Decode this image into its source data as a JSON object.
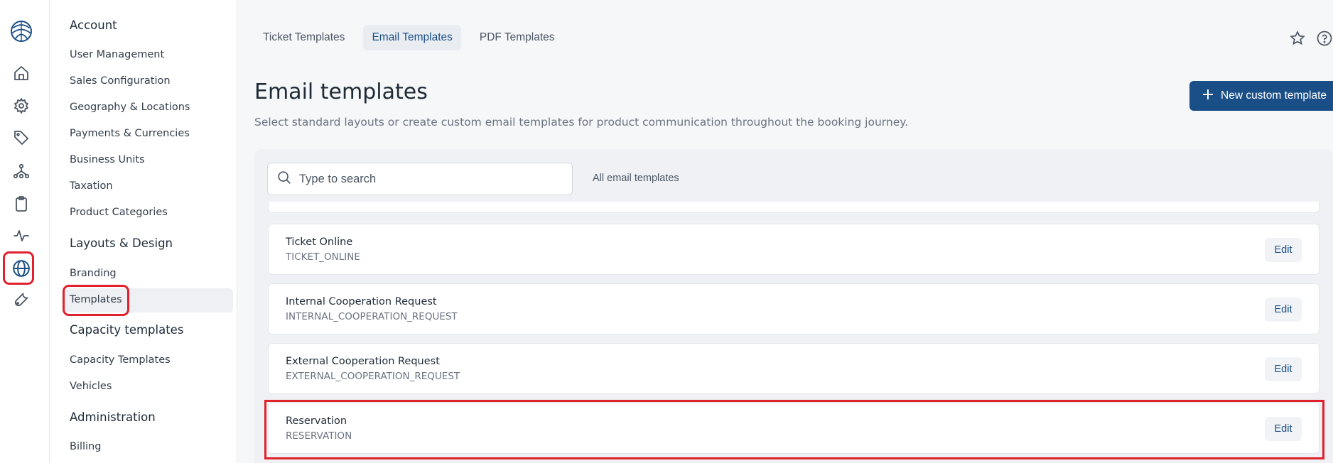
{
  "rail": {
    "icons": [
      "logo-icon",
      "home-icon",
      "settings-gear-icon",
      "tag-icon",
      "network-icon",
      "clipboard-icon",
      "activity-icon",
      "globe-icon",
      "wrench-icon"
    ],
    "active": "globe-icon",
    "highlight_color": "#e0212c"
  },
  "sidebar": {
    "sections": [
      {
        "title": "Account",
        "items": [
          "User Management",
          "Sales Configuration",
          "Geography & Locations",
          "Payments & Currencies",
          "Business Units",
          "Taxation",
          "Product Categories"
        ]
      },
      {
        "title": "Layouts & Design",
        "items": [
          "Branding",
          "Templates"
        ]
      },
      {
        "title": "Capacity templates",
        "items": [
          "Capacity Templates",
          "Vehicles"
        ]
      },
      {
        "title": "Administration",
        "items": [
          "Billing"
        ]
      }
    ],
    "active_item": "Templates"
  },
  "tabs": [
    "Ticket Templates",
    "Email Templates",
    "PDF Templates"
  ],
  "active_tab": "Email Templates",
  "header": {
    "title": "Email templates",
    "subtitle": "Select standard layouts or create custom email templates for product communication throughout the booking journey.",
    "new_button": "New custom template"
  },
  "search": {
    "placeholder": "Type to search",
    "value": ""
  },
  "filter_label": "All email templates",
  "templates": [
    {
      "name": "Ticket Online",
      "code": "TICKET_ONLINE",
      "action": "Edit"
    },
    {
      "name": "Internal Cooperation Request",
      "code": "INTERNAL_COOPERATION_REQUEST",
      "action": "Edit"
    },
    {
      "name": "External Cooperation Request",
      "code": "EXTERNAL_COOPERATION_REQUEST",
      "action": "Edit"
    },
    {
      "name": "Reservation",
      "code": "RESERVATION",
      "action": "Edit"
    }
  ],
  "colors": {
    "primary": "#1a4e86",
    "highlight": "#e0212c",
    "background": "#f6f7f9"
  }
}
